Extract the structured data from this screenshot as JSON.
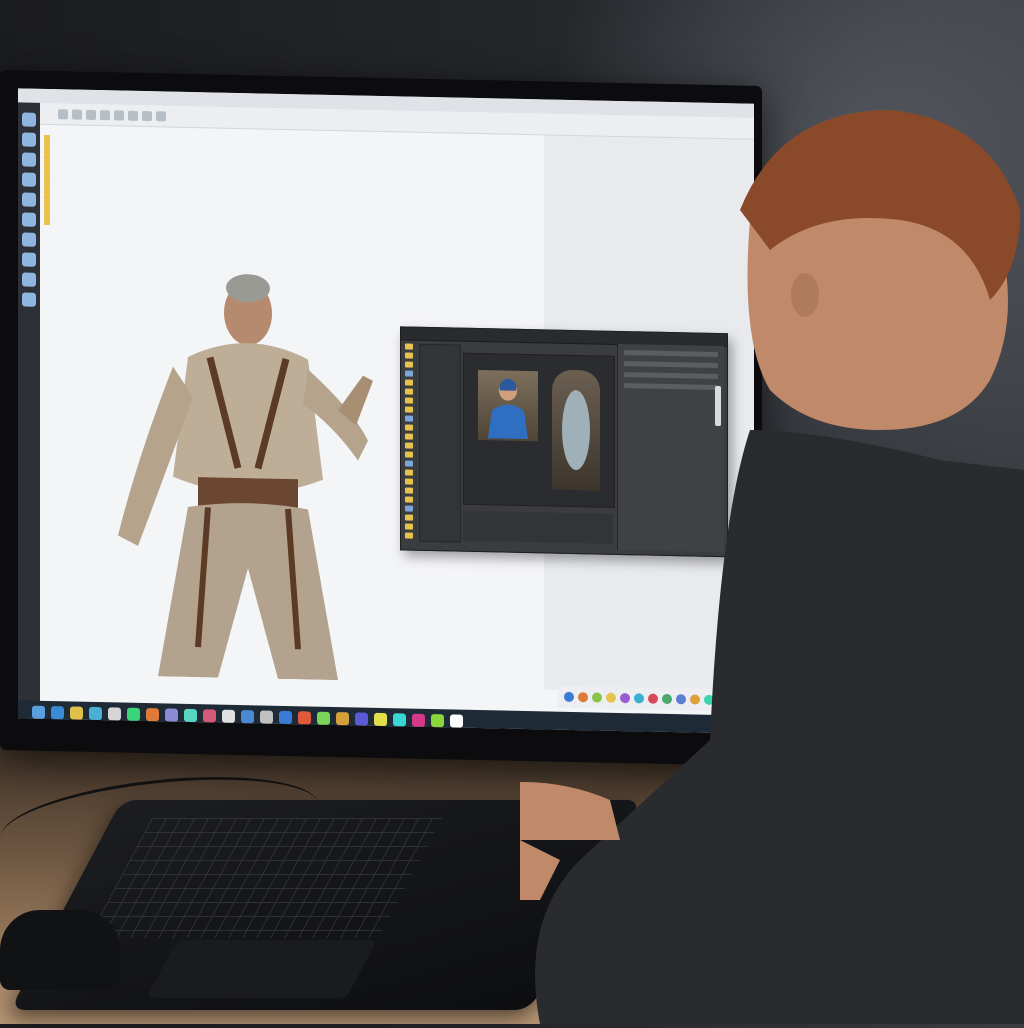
{
  "scene": {
    "description_tags": [],
    "colors": {
      "screen_bg": "#f4f5f7",
      "dialog_bg": "#3b3c3f",
      "taskbar_bg": "#1f2a37",
      "folder": "#e8c04a",
      "shirt": "#2a2b2f",
      "hair": "#8a4a2a"
    }
  },
  "monitor": {
    "file_tree": {
      "title": "",
      "items": [
        "",
        "",
        "",
        "",
        "",
        "",
        "",
        "",
        "",
        "",
        "",
        "",
        "",
        "",
        "",
        "",
        "",
        ""
      ]
    },
    "side_notes": [
      "",
      "",
      ""
    ],
    "dialog": {
      "tabs": [
        "",
        "",
        ""
      ]
    },
    "taskbar_icons": [
      "app-icon",
      "app-icon",
      "app-icon",
      "app-icon",
      "app-icon",
      "app-icon",
      "app-icon",
      "app-icon",
      "app-icon",
      "app-icon",
      "app-icon",
      "app-icon",
      "app-icon",
      "app-icon",
      "app-icon",
      "app-icon",
      "app-icon",
      "app-icon",
      "app-icon",
      "app-icon",
      "app-icon",
      "app-icon",
      "app-icon"
    ]
  }
}
